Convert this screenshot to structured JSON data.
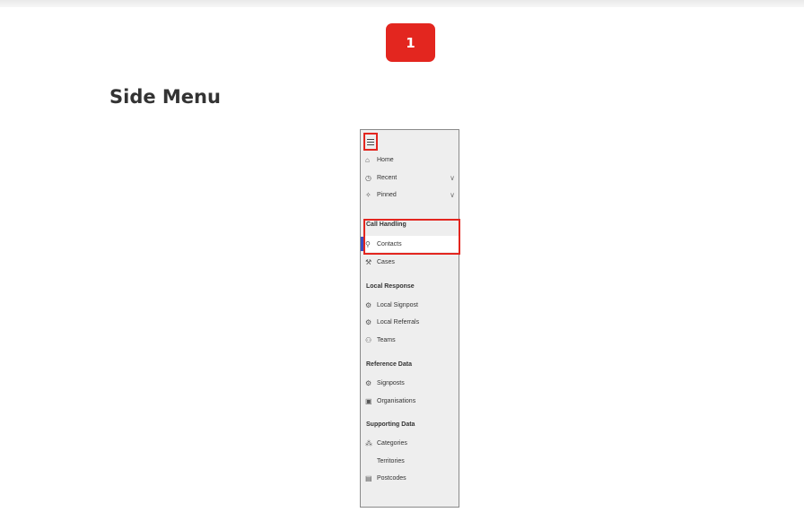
{
  "step": {
    "number": "1"
  },
  "heading": "Side Menu",
  "menu": {
    "top_items": [
      {
        "label": "Home",
        "icon": "home-icon"
      },
      {
        "label": "Recent",
        "icon": "clock-icon"
      },
      {
        "label": "Pinned",
        "icon": "pin-icon"
      }
    ],
    "groups": [
      {
        "title": "Call Handling",
        "items": [
          {
            "label": "Contacts",
            "icon": "person-icon",
            "active": true
          },
          {
            "label": "Cases",
            "icon": "wrench-icon"
          }
        ]
      },
      {
        "title": "Local Response",
        "items": [
          {
            "label": "Local Signpost",
            "icon": "signpost-icon"
          },
          {
            "label": "Local Referrals",
            "icon": "signpost-icon"
          },
          {
            "label": "Teams",
            "icon": "teams-icon"
          }
        ]
      },
      {
        "title": "Reference Data",
        "items": [
          {
            "label": "Signposts",
            "icon": "signpost-icon"
          },
          {
            "label": "Organisations",
            "icon": "organisation-icon"
          }
        ]
      },
      {
        "title": "Supporting Data",
        "items": [
          {
            "label": "Categories",
            "icon": "categories-icon"
          },
          {
            "label": "Territories",
            "icon": ""
          },
          {
            "label": "Postcodes",
            "icon": "postcode-icon"
          }
        ]
      }
    ]
  },
  "colors": {
    "highlight": "#e3261f",
    "active_indicator": "#3b4ec0"
  }
}
